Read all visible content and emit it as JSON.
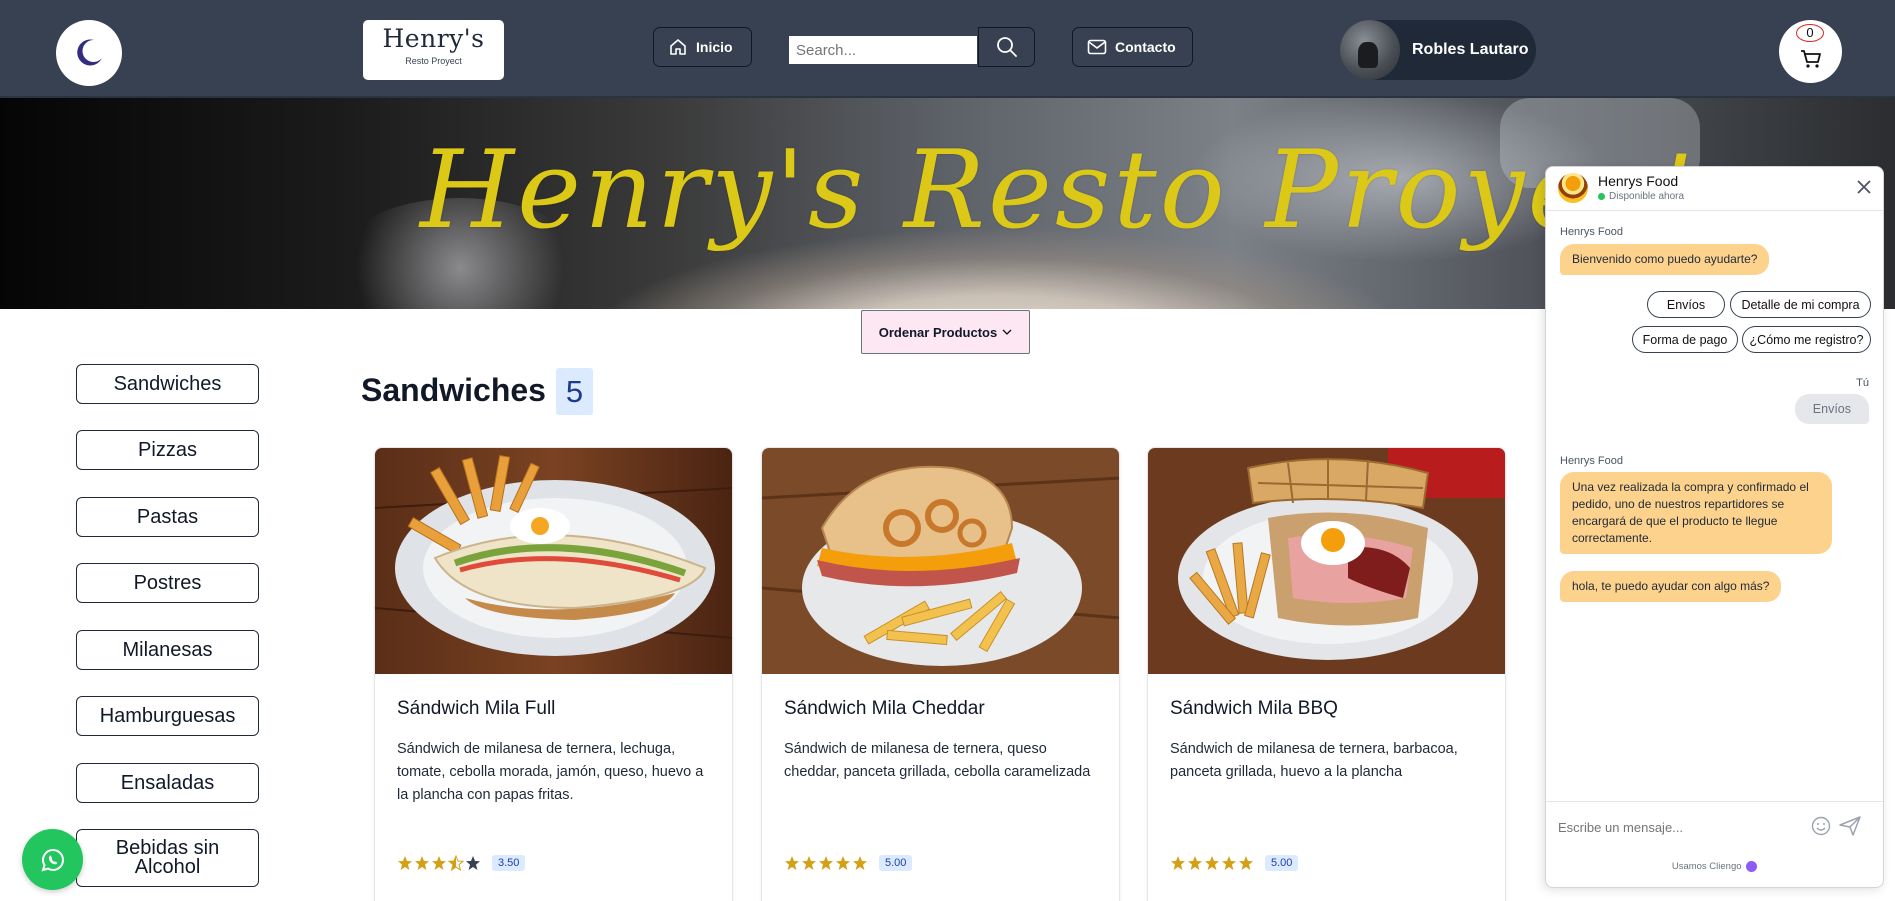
{
  "navbar": {
    "theme_icon": "moon-icon",
    "logo_title": "Henry's",
    "logo_subtitle": "Resto Proyect",
    "home_label": "Inicio",
    "home_icon": "home-icon",
    "search_placeholder": "Search...",
    "search_icon": "search-icon",
    "contact_label": "Contacto",
    "contact_icon": "mail-icon",
    "user_name": "Robles Lautaro",
    "cart_count": "0",
    "cart_icon": "cart-icon"
  },
  "hero": {
    "title": "Henry's Resto Proyect"
  },
  "sort": {
    "label": "Ordenar Productos",
    "icon": "chevron-down-icon"
  },
  "categories": [
    "Sandwiches",
    "Pizzas",
    "Pastas",
    "Postres",
    "Milanesas",
    "Hamburguesas",
    "Ensaladas",
    "Bebidas sin Alcohol"
  ],
  "section": {
    "title": "Sandwiches",
    "count": "5"
  },
  "products": [
    {
      "name": "Sándwich Mila Full",
      "description": "Sándwich de milanesa de ternera, lechuga, tomate, cebolla morada, jamón, queso, huevo a la plancha con papas fritas.",
      "rating": 3.5,
      "rating_label": "3.50"
    },
    {
      "name": "Sándwich Mila Cheddar",
      "description": "Sándwich de milanesa de ternera, queso cheddar, panceta grillada, cebolla caramelizada",
      "rating": 5,
      "rating_label": "5.00"
    },
    {
      "name": "Sándwich Mila BBQ",
      "description": "Sándwich de milanesa de ternera, barbacoa, panceta grillada, huevo a la plancha",
      "rating": 5,
      "rating_label": "5.00"
    }
  ],
  "whatsapp": {
    "icon": "whatsapp-icon"
  },
  "chat": {
    "title": "Henrys Food",
    "status": "Disponible ahora",
    "bot_name": "Henrys Food",
    "welcome": "Bienvenido como puedo ayudarte?",
    "quick_replies": [
      "Envíos",
      "Detalle de mi compra",
      "Forma de pago",
      "¿Cómo me registro?"
    ],
    "user_label": "Tú",
    "user_message": "Envíos",
    "bot_name_2": "Henrys Food",
    "answer": "Una vez realizada la compra y confirmado el pedido, uno de nuestros repartidores se encargará de que el producto te llegue correctamente.",
    "followup": "hola, te puedo ayudar con algo más?",
    "input_placeholder": "Escribe un mensaje...",
    "footer": "Usamos Cliengo",
    "colors": {
      "bot_bubble": "#fcd28d",
      "online": "#22c55e"
    }
  },
  "colors": {
    "navbar": "#374151",
    "hero_title": "#dcc816",
    "sort_bg": "#fce7f3",
    "count_bg": "#dbeafe"
  }
}
